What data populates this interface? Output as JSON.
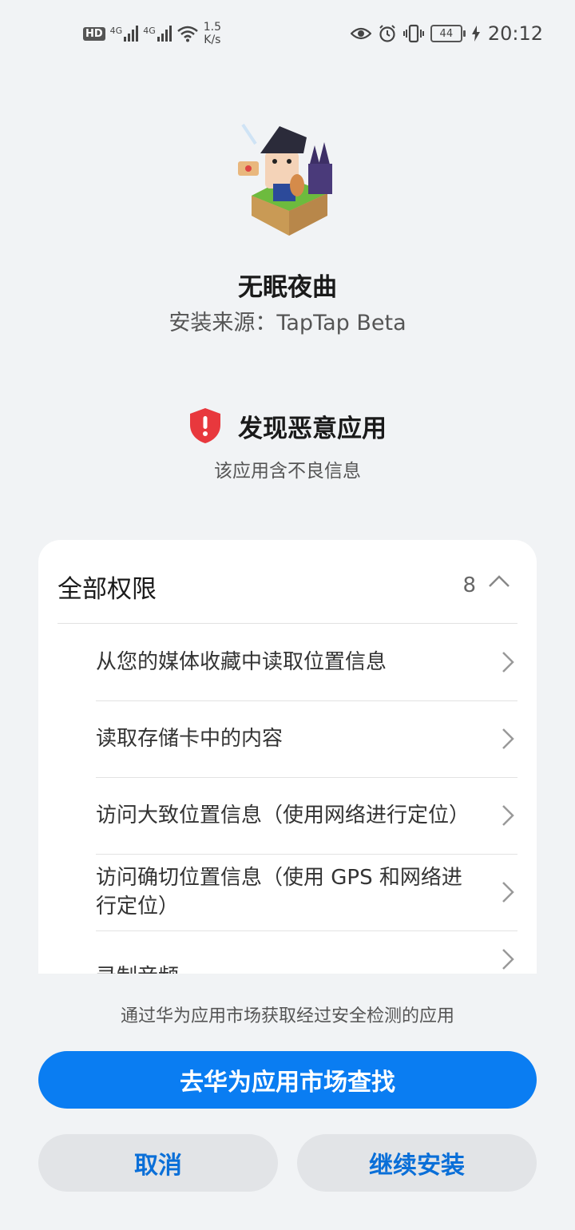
{
  "status_bar": {
    "hd_label": "HD",
    "signal_1_label": "4G",
    "signal_2_label": "4G",
    "net_speed_value": "1.5",
    "net_speed_unit": "K/s",
    "battery_level": "44",
    "time": "20:12"
  },
  "app": {
    "name": "无眠夜曲",
    "source": "安装来源：TapTap Beta"
  },
  "warning": {
    "title": "发现恶意应用",
    "subtitle": "该应用含不良信息",
    "color": "#e8383d"
  },
  "permissions": {
    "title": "全部权限",
    "count": "8",
    "items": [
      {
        "label": "从您的媒体收藏中读取位置信息"
      },
      {
        "label": "读取存储卡中的内容"
      },
      {
        "label": "访问大致位置信息（使用网络进行定位）"
      },
      {
        "label": "访问确切位置信息（使用 GPS 和网络进行定位）"
      },
      {
        "label": "录制音频"
      }
    ]
  },
  "footer": {
    "hint": "通过华为应用市场获取经过安全检测的应用",
    "primary_button": "去华为应用市场查找",
    "cancel_button": "取消",
    "continue_button": "继续安装",
    "accent_color": "#0a7df2"
  }
}
